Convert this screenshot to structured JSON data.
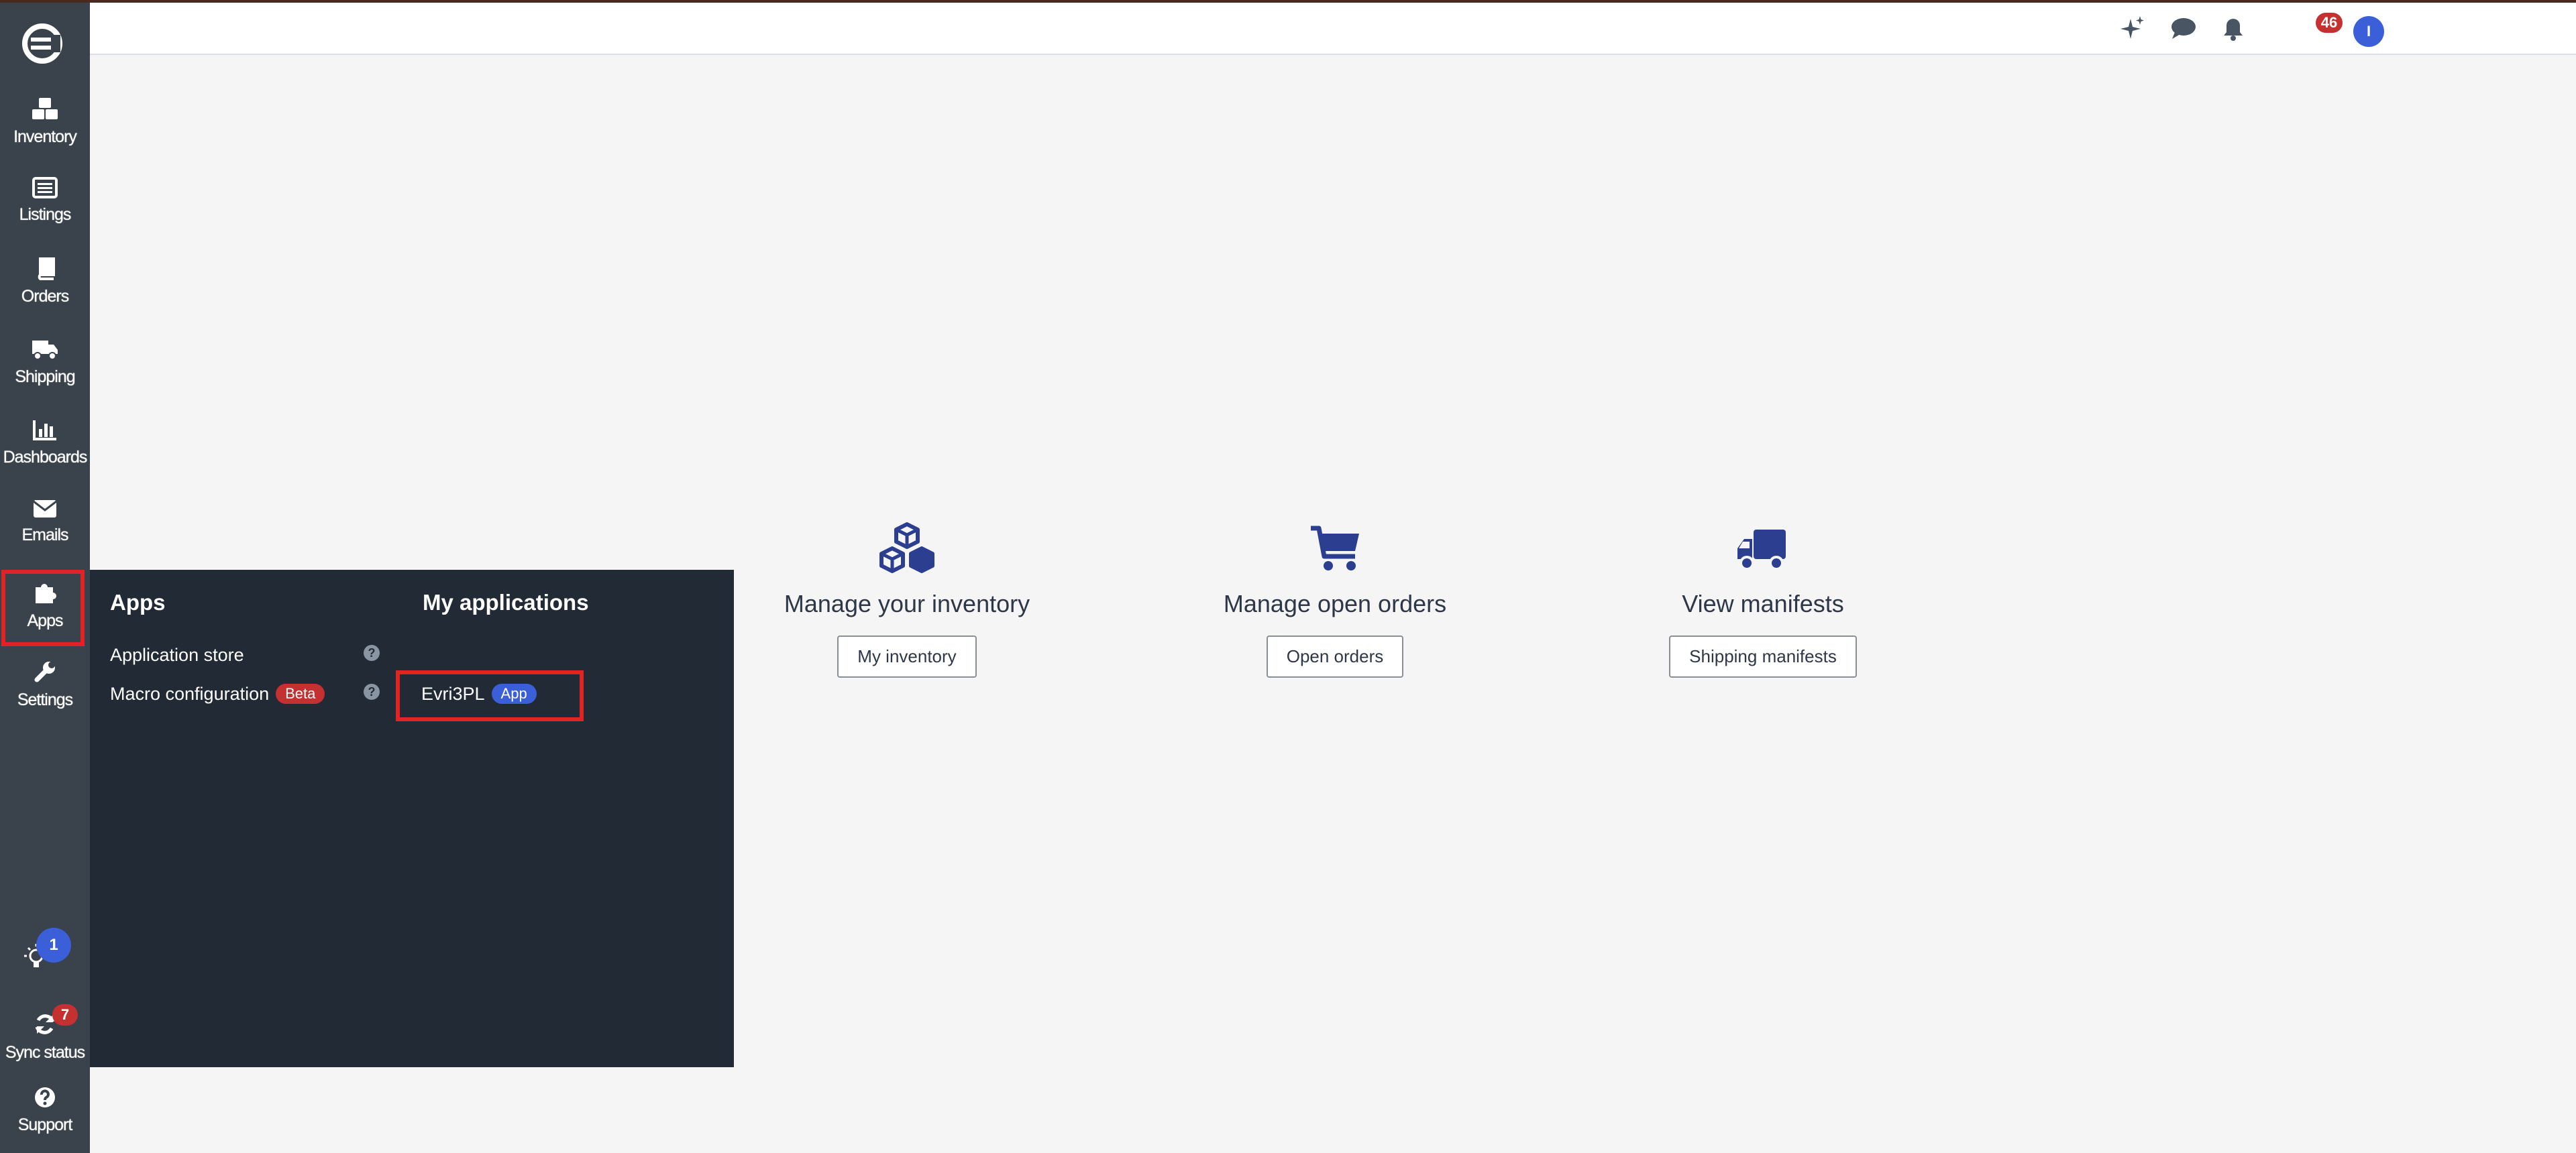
{
  "sidebar": {
    "items": [
      {
        "label": "Inventory",
        "icon": "boxes-icon"
      },
      {
        "label": "Listings",
        "icon": "list-icon"
      },
      {
        "label": "Orders",
        "icon": "book-icon"
      },
      {
        "label": "Shipping",
        "icon": "truck-icon"
      },
      {
        "label": "Dashboards",
        "icon": "bar-chart-icon"
      },
      {
        "label": "Emails",
        "icon": "envelope-icon"
      },
      {
        "label": "Apps",
        "icon": "puzzle-icon"
      },
      {
        "label": "Settings",
        "icon": "wrench-icon"
      }
    ],
    "tips_count": "1",
    "sync_label": "Sync status",
    "sync_count": "7",
    "support_label": "Support"
  },
  "topbar": {
    "notification_count": "46",
    "avatar_initial": "I"
  },
  "apps_panel": {
    "apps_heading": "Apps",
    "my_apps_heading": "My applications",
    "application_store": "Application store",
    "macro_configuration": "Macro configuration",
    "beta_badge": "Beta",
    "evri_app": "Evri3PL",
    "app_badge": "App"
  },
  "dashboard": {
    "shortcuts": [
      {
        "title": "Manage your inventory",
        "button": "My inventory"
      },
      {
        "title": "Manage open orders",
        "button": "Open orders"
      },
      {
        "title": "View manifests",
        "button": "Shipping manifests"
      }
    ]
  },
  "colors": {
    "sidebar_bg": "#3a424b",
    "panel_bg": "#222b35",
    "accent_blue": "#2c3e8f",
    "highlight_red": "#e02424",
    "badge_red": "#c53030"
  }
}
